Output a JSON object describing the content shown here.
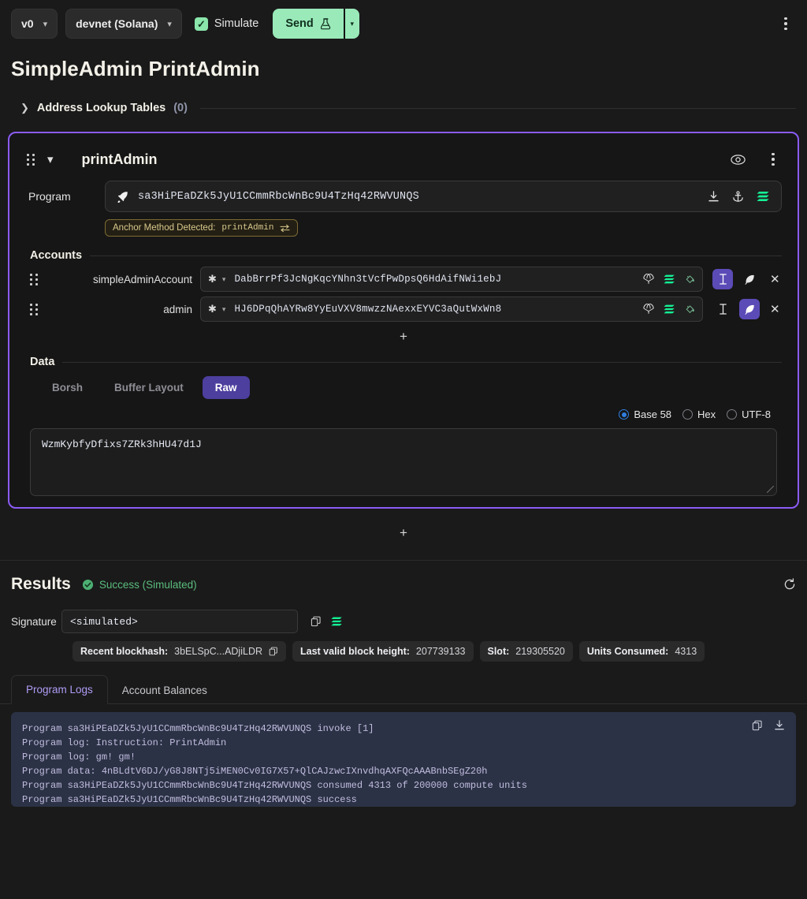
{
  "toolbar": {
    "version_select": "v0",
    "cluster_select": "devnet (Solana)",
    "simulate_label": "Simulate",
    "simulate_checked": true,
    "send_label": "Send",
    "more_menu": "kebab-menu"
  },
  "page_title": "SimpleAdmin PrintAdmin",
  "address_lookup": {
    "label": "Address Lookup Tables",
    "count": "(0)"
  },
  "instruction": {
    "name": "printAdmin",
    "program_label": "Program",
    "program_address": "sa3HiPEaDZk5JyU1CCmmRbcWnBc9U4TzHq42RWVUNQS",
    "anchor_badge_prefix": "Anchor Method Detected:",
    "anchor_badge_method": "printAdmin",
    "accounts_section": "Accounts",
    "accounts": [
      {
        "label": "simpleAdminAccount",
        "address": "DabBrrPf3JcNgKqcYNhn3tVcfPwDpsQ6HdAifNWi1ebJ",
        "writable": true,
        "signer": false
      },
      {
        "label": "admin",
        "address": "HJ6DPqQhAYRw8YyEuVXV8mwzzNAexxEYVC3aQutWxWn8",
        "writable": false,
        "signer": true
      }
    ],
    "data_section": "Data",
    "data_tabs": [
      {
        "label": "Borsh",
        "active": false
      },
      {
        "label": "Buffer Layout",
        "active": false
      },
      {
        "label": "Raw",
        "active": true
      }
    ],
    "encodings": [
      {
        "label": "Base 58",
        "selected": true
      },
      {
        "label": "Hex",
        "selected": false
      },
      {
        "label": "UTF-8",
        "selected": false
      }
    ],
    "data_value": "WzmKybfyDfixs7ZRk3hHU47d1J"
  },
  "results": {
    "title": "Results",
    "status": "Success (Simulated)",
    "status_color": "#5bbd7e",
    "signature_label": "Signature",
    "signature_value": "<simulated>",
    "chips": [
      {
        "label": "Recent blockhash:",
        "value": "3bELSpC...ADjiLDR",
        "has_copy": true
      },
      {
        "label": "Last valid block height:",
        "value": "207739133",
        "has_copy": false
      },
      {
        "label": "Slot:",
        "value": "219305520",
        "has_copy": false
      },
      {
        "label": "Units Consumed:",
        "value": "4313",
        "has_copy": false
      }
    ],
    "tabs": [
      {
        "label": "Program Logs",
        "active": true
      },
      {
        "label": "Account Balances",
        "active": false
      }
    ],
    "logs": [
      "Program sa3HiPEaDZk5JyU1CCmmRbcWnBc9U4TzHq42RWVUNQS invoke [1]",
      "Program log: Instruction: PrintAdmin",
      "Program log: gm! gm!",
      "Program data: 4nBLdtV6DJ/yG8J8NTj5iMEN0Cv0IG7X57+QlCAJzwcIXnvdhqAXFQcAAABnbSEgZ20h",
      "Program sa3HiPEaDZk5JyU1CCmmRbcWnBc9U4TzHq42RWVUNQS consumed 4313 of 200000 compute units",
      "Program sa3HiPEaDZk5JyU1CCmmRbcWnBc9U4TzHq42RWVUNQS success"
    ]
  },
  "colors": {
    "accent_purple": "#8b5cf6",
    "send_green": "#9ae9b9",
    "solana_green": "#14f195",
    "anchor_yellow": "#d9c98c"
  }
}
